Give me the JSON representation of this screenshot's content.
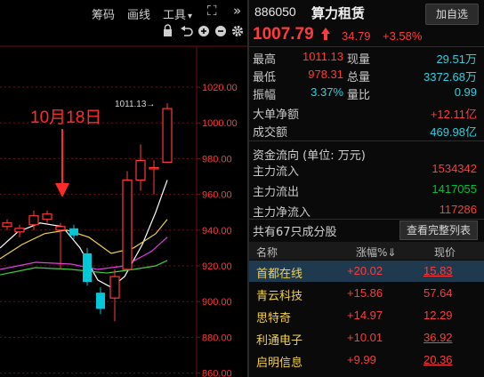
{
  "toolbar": {
    "chips_label": "筹码",
    "draw_label": "画线",
    "tools_label": "工具",
    "tools_arrow": "▾",
    "expand_icon": "⛶",
    "more_icon": "»"
  },
  "chart": {
    "annotation_date": "10月18日",
    "high_marker": "1011.13→",
    "y_ticks": [
      "1020.00",
      "1000.00",
      "980.00",
      "960.00",
      "940.00",
      "920.00",
      "900.00",
      "880.00",
      "860.00"
    ],
    "colors": {
      "up": "#ff3b3b",
      "down": "#00c8d8",
      "ma5": "#ffffff",
      "ma10": "#f0d050",
      "ma20": "#e040e0",
      "ma30": "#40d040",
      "grid": "#6b1010"
    }
  },
  "quote": {
    "code": "886050",
    "name": "算力租赁",
    "add_watch": "加自选",
    "price": "1007.79",
    "arrow": "🡑",
    "change": "34.79",
    "change_pct": "+3.58%",
    "stats": [
      {
        "l1": "最高",
        "v1": "1011.13",
        "l2": "现量",
        "v2": "29.51万"
      },
      {
        "l1": "最低",
        "v1": "978.31",
        "l2": "总量",
        "v2": "3372.68万"
      },
      {
        "l1": "振幅",
        "v1": "3.37%",
        "l2": "量比",
        "v2": "0.99"
      }
    ],
    "big_net_label": "大单净额",
    "big_net_value": "+12.11亿",
    "turnover_label": "成交额",
    "turnover_value": "469.98亿"
  },
  "fund_flow": {
    "title": "资金流向 (单位: 万元)",
    "rows": [
      {
        "label": "主力流入",
        "value": "1534342"
      },
      {
        "label": "主力流出",
        "value": "1417055"
      },
      {
        "label": "主力净流入",
        "value": "117286"
      }
    ]
  },
  "constituents": {
    "title": "共有67只成分股",
    "view_all": "查看完整列表",
    "headers": {
      "name": "名称",
      "change": "涨幅%⇓",
      "price": "现价"
    },
    "rows": [
      {
        "name": "首都在线",
        "change": "+20.02",
        "price": "15.83"
      },
      {
        "name": "青云科技",
        "change": "+15.86",
        "price": "57.64"
      },
      {
        "name": "思特奇",
        "change": "+14.97",
        "price": "12.29"
      },
      {
        "name": "利通电子",
        "change": "+10.01",
        "price": "36.92"
      },
      {
        "name": "启明信息",
        "change": "+9.99",
        "price": "20.36"
      }
    ]
  }
}
